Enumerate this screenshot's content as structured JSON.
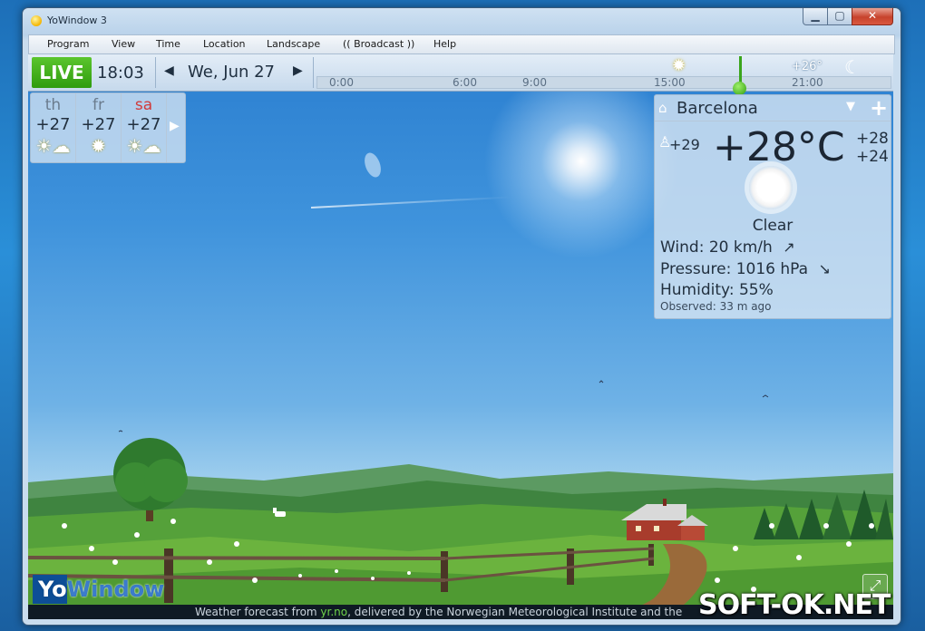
{
  "window": {
    "title": "YoWindow 3",
    "minimize": "▁",
    "maximize": "▢",
    "close": "✕"
  },
  "menu": [
    "Program",
    "View",
    "Time",
    "Location",
    "Landscape",
    "(( Broadcast ))",
    "Help"
  ],
  "topbar": {
    "live": "LIVE",
    "time": "18:03",
    "prev": "◀",
    "next": "▶",
    "date": "We, Jun 27",
    "ticks": [
      "0:00",
      "6:00",
      "9:00",
      "15:00",
      "21:00"
    ],
    "timeline_temp": "+26°",
    "timeline_sun_icon": "sun-icon",
    "timeline_moon_icon": "moon-icon"
  },
  "forecast": [
    {
      "day": "th",
      "temp": "+27",
      "icon": "sun-cloud-icon"
    },
    {
      "day": "fr",
      "temp": "+27",
      "icon": "sun-icon"
    },
    {
      "day": "sa",
      "temp": "+27",
      "icon": "sun-cloud-icon"
    }
  ],
  "forecast_next": "▶",
  "current": {
    "city": "Barcelona",
    "feels_like": "+29",
    "temperature": "+28°C",
    "high": "+28",
    "low": "+24",
    "condition": "Clear",
    "wind": {
      "label": "Wind:",
      "value": "20 km/h",
      "dir": "↗"
    },
    "pressure": {
      "label": "Pressure:",
      "value": "1016 hPa",
      "dir": "↘"
    },
    "humidity": {
      "label": "Humidity:",
      "value": "55%"
    },
    "observed": {
      "label": "Observed:",
      "value": "33 m ago"
    }
  },
  "logo": {
    "part1": "Yo",
    "part2": "Window"
  },
  "status": {
    "pre": "Weather forecast from ",
    "link": "yr.no",
    "post": ", delivered by the Norwegian Meteorological Institute and the"
  },
  "watermark": "SOFT-OK.NET"
}
